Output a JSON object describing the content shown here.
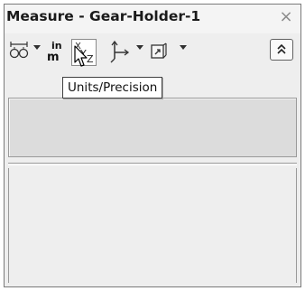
{
  "window": {
    "title": "Measure - Gear-Holder-1",
    "close_glyph": "×"
  },
  "toolbar": {
    "buttons": [
      {
        "name": "arc-circle-measure-icon",
        "has_dropdown": true
      },
      {
        "name": "units-precision-icon",
        "has_dropdown": false,
        "glyph_top": "in",
        "glyph_bottom": "m",
        "hovered": true
      },
      {
        "name": "show-xyz-measurements-icon",
        "has_dropdown": false,
        "glyph": "XYZ"
      },
      {
        "name": "point-to-point-icon",
        "has_dropdown": true
      },
      {
        "name": "coordinate-system-icon",
        "has_dropdown": true
      }
    ],
    "collapse_glyph": "⌃"
  },
  "tooltip": {
    "text": "Units/Precision"
  }
}
